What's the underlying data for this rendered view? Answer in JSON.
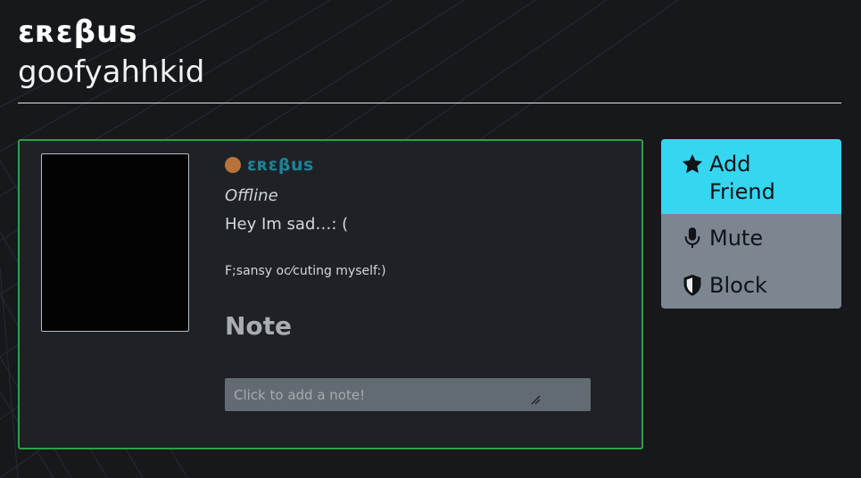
{
  "header": {
    "site_title": "ɛʀɛβus",
    "username": "goofyahhkid"
  },
  "profile": {
    "display_name": "ɛʀɛβus",
    "status": "Offline",
    "status_color": "#b8733a",
    "bio_line_1": "Hey Im sad…:  (",
    "bio_line_2": "F;sansy oc⁄cuting myself:)",
    "note_heading": "Note",
    "note_placeholder": "Click to add a note!"
  },
  "actions": {
    "add_friend_label": "Add Friend",
    "mute_label": "Mute",
    "block_label": "Block"
  },
  "colors": {
    "card_border": "#2ea043",
    "add_friend_bg": "#35d6f0",
    "actions_bg": "#7b8691",
    "name_color": "#1b8496"
  },
  "icons": {
    "add_friend": "star-icon",
    "mute": "microphone-icon",
    "block": "shield-icon"
  }
}
